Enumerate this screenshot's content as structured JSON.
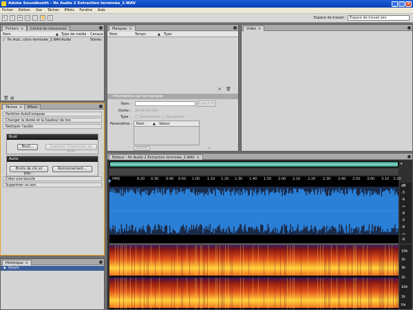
{
  "window": {
    "title": "Adobe Soundbooth - fin Audio 2 Extraction terminée_2.WAV"
  },
  "menu": [
    "Fichier",
    "Edition",
    "Vue",
    "Tâches",
    "Effets",
    "Fenêtre",
    "Aide"
  ],
  "toolbar": {
    "workspace_label": "Espace de travail :",
    "workspace_value": "Espace de travail sev"
  },
  "files_panel": {
    "tabs": [
      "Fichiers",
      "Centre de ressources"
    ],
    "columns": [
      "Nom",
      "Type de média",
      "Canaux"
    ],
    "rows": [
      {
        "name": "fin Aud...ction terminée_2.WAV",
        "type": "Audio",
        "channels": "Stéréo"
      }
    ]
  },
  "markers_panel": {
    "tab": "Marques",
    "columns": [
      "Nom",
      "Temps",
      "Type"
    ],
    "info_title": "Informations sur les marques",
    "labels": {
      "name": "Nom :",
      "duration": "Durée :",
      "type": "Type :",
      "params": "Paramètres :"
    },
    "duration_value": "00:00:00.000",
    "type_options": [
      "Evénement",
      "Navigation"
    ],
    "delete_button": "Supprimer",
    "param_columns": [
      "Nom",
      "Valeur"
    ],
    "add_button": "Ajouter"
  },
  "video_panel": {
    "tab": "Vidéo"
  },
  "tasks_panel": {
    "tabs": [
      "Tâches",
      "Effets"
    ],
    "items": [
      "Partition AutoCompose",
      "Changer la durée et la hauteur de ton",
      "Nettoyer l'audio"
    ],
    "noise_group": {
      "title": "Bruit",
      "button1": "Bruit...",
      "button2": "Capturer l'impression du bruit"
    },
    "other_group": {
      "title": "Autre",
      "button1": "Bruits de clic et pop...",
      "button2": "Ronronnement..."
    },
    "more_items": [
      "Créer une boucle",
      "Supprimer un son"
    ]
  },
  "history_panel": {
    "tab": "Historique",
    "items": [
      "Ouvrir"
    ]
  },
  "editor": {
    "tab": "Éditeur : fin Audio 2 Extraction terminée_2.WAV",
    "ruler_labels": [
      "HMS",
      "0:20",
      "0:30",
      "0:40",
      "0:50",
      "1:00",
      "1:10",
      "1:20",
      "1:30",
      "1:40",
      "1:50",
      "2:00",
      "2:10",
      "2:20",
      "2:30",
      "2:40",
      "2:50",
      "3:00",
      "3:10",
      "3:20"
    ],
    "wave_scale": [
      "dB",
      "-3",
      "-9",
      "-∞",
      "-9",
      "-3",
      "-9",
      "-∞",
      "-9"
    ],
    "spec_scale": [
      "10k",
      "1k",
      "3k",
      "1k",
      "10k",
      "1k",
      "Hz"
    ],
    "colors": {
      "waveform": "#2a7fd6",
      "waveform_peaks": "#1b2b4a",
      "spectrum_hot": "#ffd23a",
      "spectrum_cool": "#8a1a10"
    }
  }
}
